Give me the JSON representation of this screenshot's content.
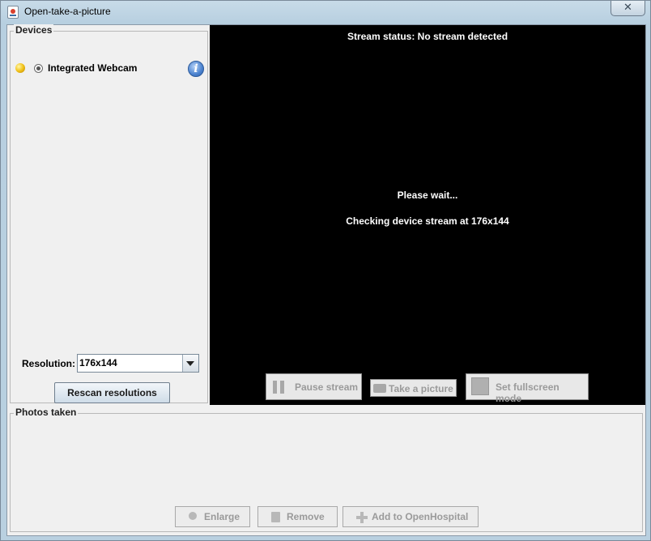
{
  "window": {
    "title": "Open-take-a-picture",
    "close_label": "✕"
  },
  "devices": {
    "legend": "Devices",
    "items": [
      {
        "label": "Integrated Webcam",
        "selected": true,
        "status_color": "#f2c21a"
      }
    ],
    "info_glyph": "i",
    "resolution_label": "Resolution:",
    "resolution_value": "176x144",
    "rescan_label": "Rescan resolutions"
  },
  "stream": {
    "status": "Stream status: No stream detected",
    "wait": "Please wait...",
    "checking": "Checking device stream at 176x144",
    "pause_label": "Pause stream",
    "picture_label": "Take a picture",
    "fullscreen_label": "Set fullscreen mode"
  },
  "photos": {
    "legend": "Photos taken",
    "enlarge_label": "Enlarge",
    "remove_label": "Remove",
    "add_label": "Add to OpenHospital"
  },
  "icons": {
    "app": "java-app-icon",
    "info": "info-icon",
    "pause": "pause-icon",
    "camera": "camera-icon",
    "fullscreen": "fullscreen-icon",
    "enlarge": "magnifier-icon",
    "remove": "trash-icon",
    "add": "plus-icon"
  }
}
